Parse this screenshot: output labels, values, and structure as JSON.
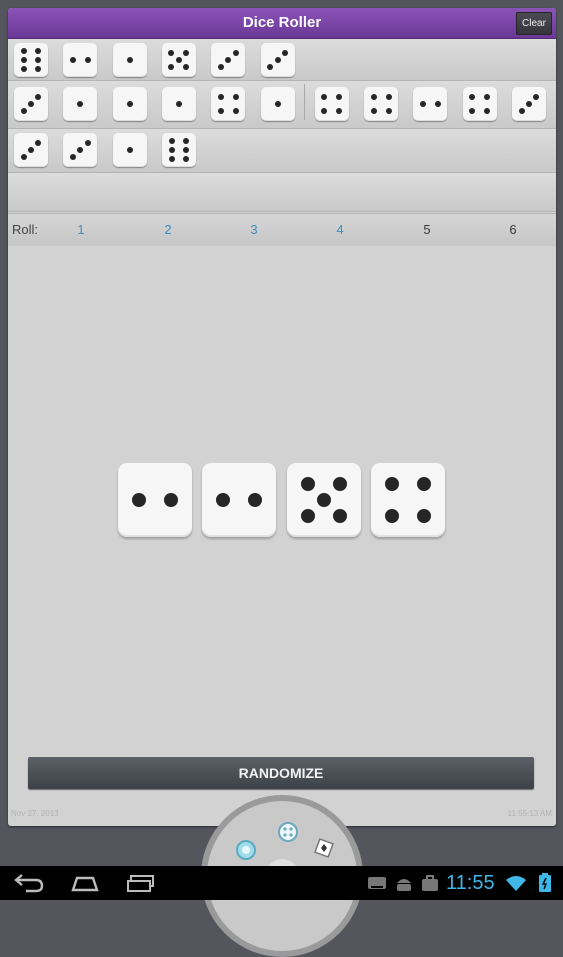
{
  "app": {
    "title": "Dice Roller",
    "clear_label": "Clear"
  },
  "history": [
    [
      6,
      2,
      1,
      5,
      3,
      3
    ],
    [
      3,
      1,
      1,
      1,
      4,
      1,
      4,
      4,
      2,
      4,
      3
    ],
    [
      3,
      3,
      1,
      6
    ],
    []
  ],
  "roll": {
    "label": "Roll:",
    "options": [
      {
        "label": "1",
        "selected": false
      },
      {
        "label": "2",
        "selected": false
      },
      {
        "label": "3",
        "selected": false
      },
      {
        "label": "4",
        "selected": false
      },
      {
        "label": "5",
        "selected": true
      },
      {
        "label": "6",
        "selected": true
      }
    ]
  },
  "current_roll": [
    2,
    2,
    5,
    4
  ],
  "randomize_label": "RANDOMIZE",
  "footer": {
    "date": "Nov 27, 2013",
    "time": "11:55:13 AM"
  },
  "status": {
    "clock": "11:55"
  },
  "icons": {
    "nav": [
      "back-icon",
      "home-icon",
      "recent-apps-icon"
    ],
    "status": [
      "keyboard-icon",
      "android-icon",
      "briefcase-icon",
      "wifi-icon",
      "battery-icon"
    ],
    "wheel": [
      "coin-icon",
      "dice-icon",
      "card-icon"
    ]
  },
  "colors": {
    "title_bar": "#7a45a8",
    "accent": "#3a8fc2",
    "clock": "#3fb7e8"
  }
}
